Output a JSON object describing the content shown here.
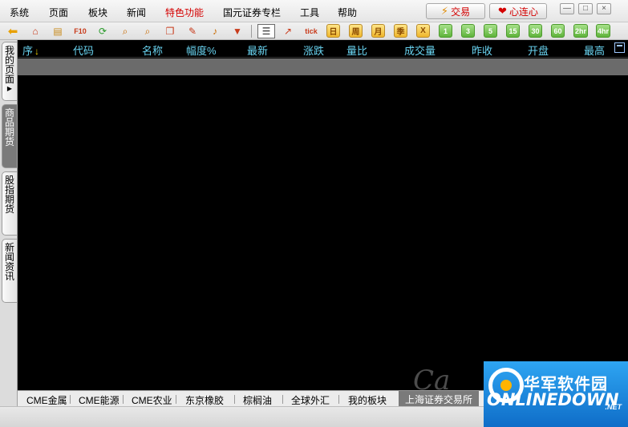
{
  "menu": {
    "items": [
      "系统",
      "页面",
      "板块",
      "新闻",
      "特色功能",
      "国元证券专栏",
      "工具",
      "帮助"
    ],
    "highlight_index": 4,
    "trade_button": "交易",
    "heart_button": "心连心",
    "win_min": "—",
    "win_max": "□",
    "win_close": "×"
  },
  "toolbar": {
    "tick": "tick",
    "periods": [
      "日",
      "周",
      "月",
      "季",
      "X"
    ],
    "numbers": [
      "1",
      "3",
      "5",
      "15",
      "30",
      "60",
      "2hr",
      "4hr"
    ]
  },
  "left_tabs": [
    {
      "label": "我的页面",
      "active": false
    },
    {
      "label": "商品期货",
      "active": true
    },
    {
      "label": "股指期货",
      "active": false
    },
    {
      "label": "新闻资讯",
      "active": false
    }
  ],
  "grid": {
    "columns": [
      "序",
      "代码",
      "名称",
      "幅度%",
      "最新",
      "涨跌",
      "量比",
      "成交量",
      "昨收",
      "开盘",
      "最高"
    ],
    "sort_arrow": "↓"
  },
  "bottom_tabs": {
    "items": [
      "CME金属",
      "CME能源",
      "CME农业",
      "东京橡胶",
      "棕榈油",
      "全球外汇",
      "我的板块",
      "上海证券交易所"
    ],
    "active_index": 7
  },
  "watermark": {
    "top": "华军软件园",
    "bottom": "ONLINEDOWN",
    "net": ".NET"
  },
  "colors": {
    "header_text": "#69d3f0",
    "grid_bg": "#000000",
    "menu_highlight": "#d40000"
  }
}
